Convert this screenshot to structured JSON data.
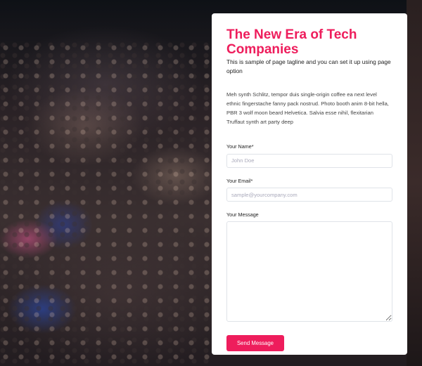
{
  "form": {
    "title": "The New Era of Tech Companies",
    "tagline": "This is sample of page tagline and you can set it up using page option",
    "description": "Meh synth Schlitz, tempor duis single-origin coffee ea next level ethnic fingerstache fanny pack nostrud. Photo booth anim 8-bit hella, PBR 3 wolf moon beard Helvetica. Salvia esse nihil, flexitarian Truffaut synth art party deep",
    "fields": {
      "name": {
        "label": "Your Name*",
        "placeholder": "John Doe"
      },
      "email": {
        "label": "Your Email*",
        "placeholder": "sample@yourcompany.com"
      },
      "message": {
        "label": "Your Message",
        "placeholder": ""
      }
    },
    "submit_label": "Send Message"
  },
  "colors": {
    "accent": "#ee1d5c",
    "card_background": "#ffffff",
    "input_border": "#dfe3e8"
  }
}
